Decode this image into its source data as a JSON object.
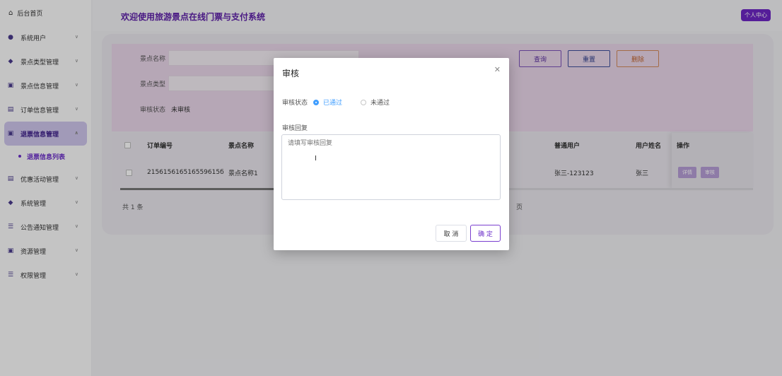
{
  "sidebar": {
    "home": "后台首页",
    "items": [
      {
        "label": "系统用户",
        "icon": "user-icon"
      },
      {
        "label": "景点类型管理",
        "icon": "type-icon"
      },
      {
        "label": "景点信息管理",
        "icon": "info-icon"
      },
      {
        "label": "订单信息管理",
        "icon": "order-icon"
      },
      {
        "label": "退票信息管理",
        "icon": "refund-icon",
        "active": true
      },
      {
        "label": "优惠活动管理",
        "icon": "promo-icon"
      },
      {
        "label": "系统管理",
        "icon": "system-icon"
      },
      {
        "label": "公告通知管理",
        "icon": "notice-icon"
      },
      {
        "label": "资源管理",
        "icon": "resource-icon"
      },
      {
        "label": "权限管理",
        "icon": "permission-icon"
      }
    ],
    "sub_item": "退票信息列表"
  },
  "header": {
    "title": "欢迎使用旅游景点在线门票与支付系统",
    "user_center": "个人中心"
  },
  "filters": {
    "spot_name_label": "景点名称",
    "spot_type_label": "景点类型",
    "audit_status_label": "审核状态",
    "audit_status_value": "未审核",
    "query_btn": "查询",
    "reset_btn": "重置",
    "delete_btn": "删除"
  },
  "table": {
    "headers": {
      "order_no": "订单编号",
      "spot_name": "景点名称",
      "user": "普通用户",
      "user_name": "用户姓名",
      "ops": "操作"
    },
    "row": {
      "order_no": "215615616516559615б",
      "spot_name": "景点名称1",
      "user": "张三-123123",
      "user_name": "张三",
      "detail_btn": "详情",
      "audit_btn": "审核"
    }
  },
  "pager": {
    "total": "共 1 条",
    "page": "页"
  },
  "dialog": {
    "title": "审核",
    "status_label": "审核状态",
    "pass": "已通过",
    "fail": "未通过",
    "reply_label": "审核回复",
    "reply_placeholder": "请填写审核回复",
    "cancel": "取 消",
    "confirm": "确 定"
  },
  "colors": {
    "accent": "#6c2fc9",
    "radio_active": "#409eff",
    "header_title": "#5d1fa8"
  }
}
